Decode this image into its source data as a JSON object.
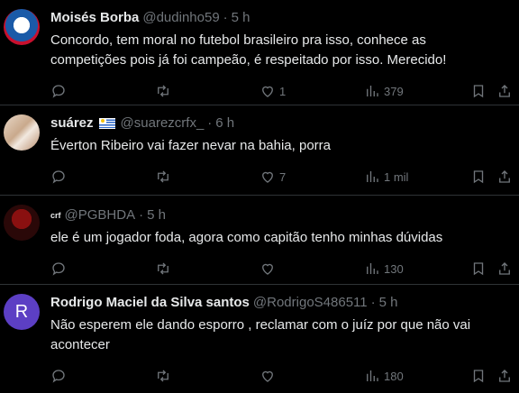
{
  "tweets": [
    {
      "name": "Moisés Borba",
      "handle": "@dudinho59",
      "time": "5 h",
      "text": "Concordo, tem moral no futebol brasileiro pra isso, conhece as competições pois já foi campeão, é respeitado por isso. Merecido!",
      "likes": "1",
      "views": "379"
    },
    {
      "name": "suárez",
      "handle": "@suarezcrfx_",
      "time": "6 h",
      "text": "Éverton Ribeiro vai fazer nevar na bahia, porra",
      "likes": "7",
      "views": "1 mil"
    },
    {
      "name": "crf",
      "handle": "@PGBHDA",
      "time": "5 h",
      "text": "ele é um jogador foda, agora como capitão tenho minhas dúvidas",
      "likes": "",
      "views": "130"
    },
    {
      "name": "Rodrigo Maciel da Silva santos",
      "handle": "@RodrigoS486511",
      "time": "5 h",
      "avatar_letter": "R",
      "text": "Não esperem ele dando esporro , reclamar com o juíz por que não vai acontecer",
      "likes": "",
      "views": "180"
    }
  ],
  "separator": "·",
  "icons": [
    "reply-icon",
    "retweet-icon",
    "like-icon",
    "views-icon",
    "bookmark-icon",
    "share-icon"
  ],
  "colors": {
    "background": "#000000",
    "text": "#e7e9ea",
    "muted": "#71767b",
    "divider": "#2f3336"
  }
}
